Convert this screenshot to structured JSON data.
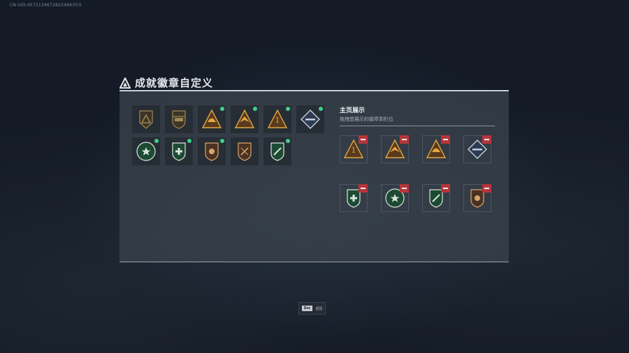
{
  "header": {
    "uid": "CN UID:457213467282246835i5"
  },
  "dialog": {
    "title": "成就徽章自定义",
    "showcase_title": "主页展示",
    "showcase_subtitle": "拖拽想展示的徽章到栏位"
  },
  "badges": [
    {
      "icon": "triangle-emblem-icon",
      "variant": "dark-gold",
      "new": false
    },
    {
      "icon": "helicopter-badge-icon",
      "variant": "dark-gold",
      "new": false
    },
    {
      "icon": "helmet-badge-icon",
      "variant": "gold",
      "new": true
    },
    {
      "icon": "eagle-badge-icon",
      "variant": "gold",
      "new": true
    },
    {
      "icon": "rank-one-badge-icon",
      "variant": "gold",
      "new": true
    },
    {
      "icon": "rifle-badge-icon",
      "variant": "silver",
      "new": true
    },
    {
      "icon": "star-wreath-badge-icon",
      "variant": "green",
      "new": true
    },
    {
      "icon": "medic-cross-badge-icon",
      "variant": "green",
      "new": true
    },
    {
      "icon": "lion-shield-badge-icon",
      "variant": "bronze",
      "new": true
    },
    {
      "icon": "crossed-blade-badge-icon",
      "variant": "bronze",
      "new": false
    },
    {
      "icon": "dagger-shield-badge-icon",
      "variant": "green",
      "new": true
    }
  ],
  "showcase": [
    {
      "icon": "rank-one-badge-icon",
      "variant": "gold"
    },
    {
      "icon": "eagle-badge-icon",
      "variant": "gold"
    },
    {
      "icon": "helmet-badge-icon",
      "variant": "gold"
    },
    {
      "icon": "rifle-badge-icon",
      "variant": "silver"
    },
    {
      "icon": "medic-cross-badge-icon",
      "variant": "green"
    },
    {
      "icon": "star-wreath-badge-icon",
      "variant": "green"
    },
    {
      "icon": "dagger-shield-badge-icon",
      "variant": "green"
    },
    {
      "icon": "lion-shield-badge-icon",
      "variant": "bronze"
    }
  ],
  "footer": {
    "esc_key": "Esc",
    "esc_label": "返回"
  },
  "colors": {
    "new_dot": "#3fd08a",
    "remove": "#b8343a",
    "panel": "#3a424c"
  }
}
